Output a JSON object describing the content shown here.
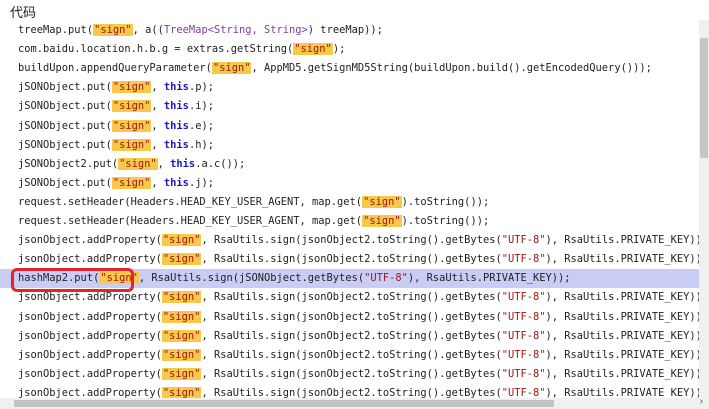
{
  "header": {
    "title": "代码"
  },
  "code_lines": [
    [
      {
        "t": "treeMap.put(",
        "c": ""
      },
      {
        "t": "\"sign\"",
        "c": "hl"
      },
      {
        "t": ", a((",
        "c": ""
      },
      {
        "t": "TreeMap<String, String>",
        "c": "t"
      },
      {
        "t": ") treeMap));",
        "c": ""
      }
    ],
    [
      {
        "t": "com.baidu.location.h.b.g = extras.getString(",
        "c": ""
      },
      {
        "t": "\"sign\"",
        "c": "hl"
      },
      {
        "t": ");",
        "c": ""
      }
    ],
    [
      {
        "t": "buildUpon.appendQueryParameter(",
        "c": ""
      },
      {
        "t": "\"sign\"",
        "c": "hl"
      },
      {
        "t": ", AppMD5.getSignMD5String(buildUpon.build().getEncodedQuery()));",
        "c": ""
      }
    ],
    [
      {
        "t": "jSONObject.put(",
        "c": ""
      },
      {
        "t": "\"sign\"",
        "c": "hl"
      },
      {
        "t": ", ",
        "c": ""
      },
      {
        "t": "this",
        "c": "k"
      },
      {
        "t": ".p);",
        "c": ""
      }
    ],
    [
      {
        "t": "jSONObject.put(",
        "c": ""
      },
      {
        "t": "\"sign\"",
        "c": "hl"
      },
      {
        "t": ", ",
        "c": ""
      },
      {
        "t": "this",
        "c": "k"
      },
      {
        "t": ".i);",
        "c": ""
      }
    ],
    [
      {
        "t": "jSONObject.put(",
        "c": ""
      },
      {
        "t": "\"sign\"",
        "c": "hl"
      },
      {
        "t": ", ",
        "c": ""
      },
      {
        "t": "this",
        "c": "k"
      },
      {
        "t": ".e);",
        "c": ""
      }
    ],
    [
      {
        "t": "jSONObject.put(",
        "c": ""
      },
      {
        "t": "\"sign\"",
        "c": "hl"
      },
      {
        "t": ", ",
        "c": ""
      },
      {
        "t": "this",
        "c": "k"
      },
      {
        "t": ".h);",
        "c": ""
      }
    ],
    [
      {
        "t": "jSONObject2.put(",
        "c": ""
      },
      {
        "t": "\"sign\"",
        "c": "hl"
      },
      {
        "t": ", ",
        "c": ""
      },
      {
        "t": "this",
        "c": "k"
      },
      {
        "t": ".a.c());",
        "c": ""
      }
    ],
    [
      {
        "t": "jSONObject.put(",
        "c": ""
      },
      {
        "t": "\"sign\"",
        "c": "hl"
      },
      {
        "t": ", ",
        "c": ""
      },
      {
        "t": "this",
        "c": "k"
      },
      {
        "t": ".j);",
        "c": ""
      }
    ],
    [
      {
        "t": "request.setHeader(Headers.HEAD_KEY_USER_AGENT, map.get(",
        "c": ""
      },
      {
        "t": "\"sign\"",
        "c": "hl"
      },
      {
        "t": ").toString());",
        "c": ""
      }
    ],
    [
      {
        "t": "request.setHeader(Headers.HEAD_KEY_USER_AGENT, map.get(",
        "c": ""
      },
      {
        "t": "\"sign\"",
        "c": "hl"
      },
      {
        "t": ").toString());",
        "c": ""
      }
    ],
    [
      {
        "t": "jsonObject.addProperty(",
        "c": ""
      },
      {
        "t": "\"sign\"",
        "c": "hl"
      },
      {
        "t": ", RsaUtils.sign(jsonObject2.toString().getBytes(",
        "c": ""
      },
      {
        "t": "\"UTF-8\"",
        "c": "s"
      },
      {
        "t": "), RsaUtils.PRIVATE_KEY));",
        "c": ""
      }
    ],
    [
      {
        "t": "jsonObject.addProperty(",
        "c": ""
      },
      {
        "t": "\"sign\"",
        "c": "hl"
      },
      {
        "t": ", RsaUtils.sign(jsonObject2.toString().getBytes(",
        "c": ""
      },
      {
        "t": "\"UTF-8\"",
        "c": "s"
      },
      {
        "t": "), RsaUtils.PRIVATE_KEY));",
        "c": ""
      }
    ],
    [
      {
        "t": "hashMap2.put(",
        "c": ""
      },
      {
        "t": "\"sign\"",
        "c": "hl"
      },
      {
        "t": ", RsaUtils.sign(jSONObject.getBytes(",
        "c": ""
      },
      {
        "t": "\"UTF-8\"",
        "c": "s"
      },
      {
        "t": "), RsaUtils.PRIVATE_KEY));",
        "c": ""
      }
    ],
    [
      {
        "t": "jsonObject.addProperty(",
        "c": ""
      },
      {
        "t": "\"sign\"",
        "c": "hl"
      },
      {
        "t": ", RsaUtils.sign(jsonObject2.toString().getBytes(",
        "c": ""
      },
      {
        "t": "\"UTF-8\"",
        "c": "s"
      },
      {
        "t": "), RsaUtils.PRIVATE_KEY));",
        "c": ""
      }
    ],
    [
      {
        "t": "jsonObject.addProperty(",
        "c": ""
      },
      {
        "t": "\"sign\"",
        "c": "hl"
      },
      {
        "t": ", RsaUtils.sign(jsonObject2.toString().getBytes(",
        "c": ""
      },
      {
        "t": "\"UTF-8\"",
        "c": "s"
      },
      {
        "t": "), RsaUtils.PRIVATE_KEY));",
        "c": ""
      }
    ],
    [
      {
        "t": "jsonObject.addProperty(",
        "c": ""
      },
      {
        "t": "\"sign\"",
        "c": "hl"
      },
      {
        "t": ", RsaUtils.sign(jsonObject2.toString().getBytes(",
        "c": ""
      },
      {
        "t": "\"UTF-8\"",
        "c": "s"
      },
      {
        "t": "), RsaUtils.PRIVATE_KEY));",
        "c": ""
      }
    ],
    [
      {
        "t": "jsonObject.addProperty(",
        "c": ""
      },
      {
        "t": "\"sign\"",
        "c": "hl"
      },
      {
        "t": ", RsaUtils.sign(jsonObject2.toString().getBytes(",
        "c": ""
      },
      {
        "t": "\"UTF-8\"",
        "c": "s"
      },
      {
        "t": "), RsaUtils.PRIVATE_KEY));",
        "c": ""
      }
    ],
    [
      {
        "t": "jsonObject.addProperty(",
        "c": ""
      },
      {
        "t": "\"sign\"",
        "c": "hl"
      },
      {
        "t": ", RsaUtils.sign(jsonObject2.toString().getBytes(",
        "c": ""
      },
      {
        "t": "\"UTF-8\"",
        "c": "s"
      },
      {
        "t": "), RsaUtils.PRIVATE_KEY));",
        "c": ""
      }
    ],
    [
      {
        "t": "jsonObject.addProperty(",
        "c": ""
      },
      {
        "t": "\"sign\"",
        "c": "hl"
      },
      {
        "t": ", RsaUtils.sign(jsonObject2.toString().getBytes(",
        "c": ""
      },
      {
        "t": "\"UTF-8\"",
        "c": "s"
      },
      {
        "t": "), RsaUtils.PRIVATE_KEY));",
        "c": ""
      }
    ]
  ],
  "selected_line_index": 13,
  "annotation": {
    "color": "#e3242b",
    "target_line_index": 13
  },
  "icons": {
    "scroll_right": "chevron-right-icon"
  }
}
